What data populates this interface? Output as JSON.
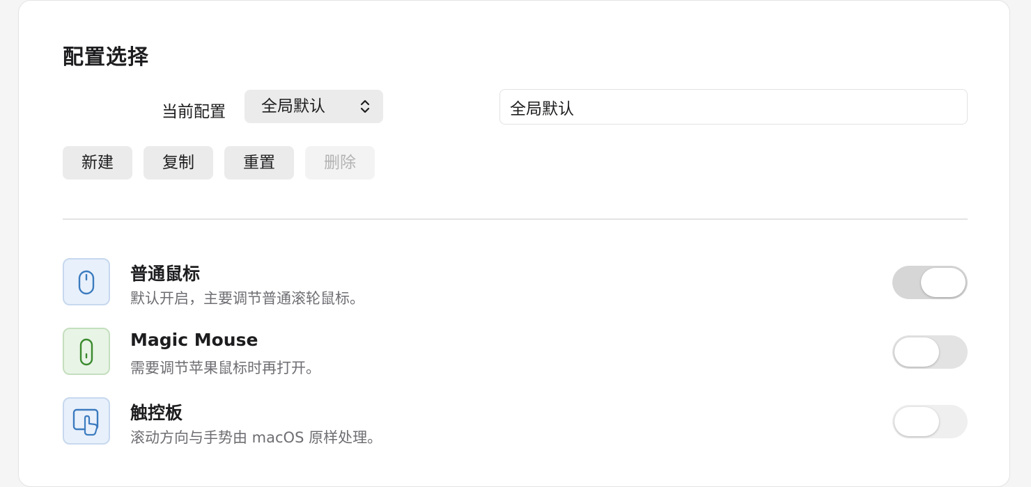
{
  "section": {
    "title": "配置选择"
  },
  "config": {
    "current_label": "当前配置",
    "selected": "全局默认",
    "name_value": "全局默认"
  },
  "buttons": {
    "new": "新建",
    "copy": "复制",
    "reset": "重置",
    "delete": "删除"
  },
  "devices": [
    {
      "icon": "mouse-icon",
      "title": "普通鼠标",
      "description": "默认开启，主要调节普通滚轮鼠标。",
      "enabled": true,
      "icon_color": "#3b7bbf"
    },
    {
      "icon": "magic-mouse-icon",
      "title": "Magic Mouse",
      "description": "需要调节苹果鼠标时再打开。",
      "enabled": false,
      "icon_color": "#3a8a2e"
    },
    {
      "icon": "trackpad-icon",
      "title": "触控板",
      "description": "滚动方向与手势由 macOS 原样处理。",
      "enabled": false,
      "icon_color": "#3b7bbf"
    }
  ]
}
